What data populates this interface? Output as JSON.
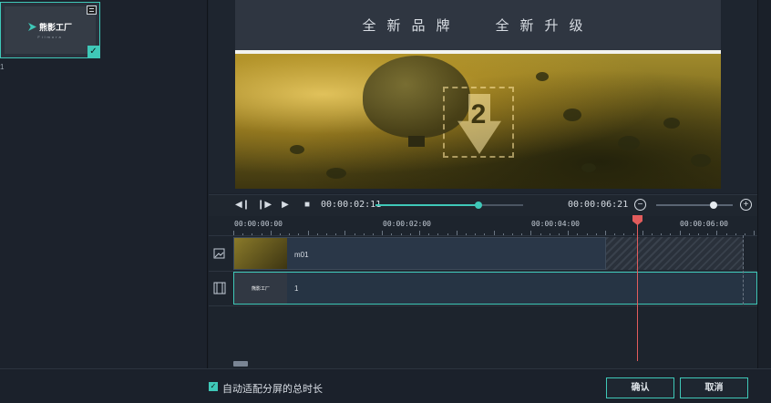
{
  "media": {
    "thumb_logo_text": "熊影工厂",
    "thumb_sub_text": "Filmora",
    "thumb_label": "1"
  },
  "preview": {
    "banner_left": "全新品牌",
    "banner_right": "全新升级",
    "countdown_number": "2"
  },
  "transport": {
    "current_time": "00:00:02:11",
    "total_time": "00:00:06:21",
    "progress_fraction": 0.7,
    "zoom_fraction": 0.75
  },
  "ruler": {
    "labels": [
      "00:00:00:00",
      "00:00:02:00",
      "00:00:04:00",
      "00:00:06:00"
    ]
  },
  "tracks": {
    "video_clip_label": "m01",
    "overlay_clip_label": "1"
  },
  "footer": {
    "auto_fit_label": "自动适配分屏的总时长",
    "auto_fit_checked": true,
    "confirm_label": "确认",
    "cancel_label": "取消"
  },
  "colors": {
    "accent": "#3fc8b8",
    "playhead": "#e25c5c",
    "background": "#1b212b"
  }
}
